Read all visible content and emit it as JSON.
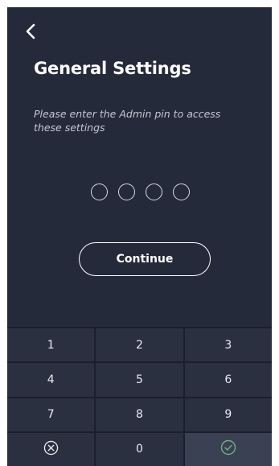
{
  "header": {
    "back_icon": "chevron-left-icon",
    "title": "General Settings",
    "description": "Please enter the Admin pin to access these settings"
  },
  "pin": {
    "length": 4,
    "entered": 0
  },
  "continue_label": "Continue",
  "keypad": {
    "rows": [
      [
        "1",
        "2",
        "3"
      ],
      [
        "4",
        "5",
        "6"
      ],
      [
        "7",
        "8",
        "9"
      ]
    ],
    "zero": "0",
    "clear_icon": "circle-x-icon",
    "confirm_icon": "circle-check-icon"
  },
  "colors": {
    "background": "#252a3a",
    "keypad_background": "#2b3040",
    "confirm_key": "#3a4152",
    "text": "#ffffff",
    "confirm_check": "#6fae8a"
  }
}
